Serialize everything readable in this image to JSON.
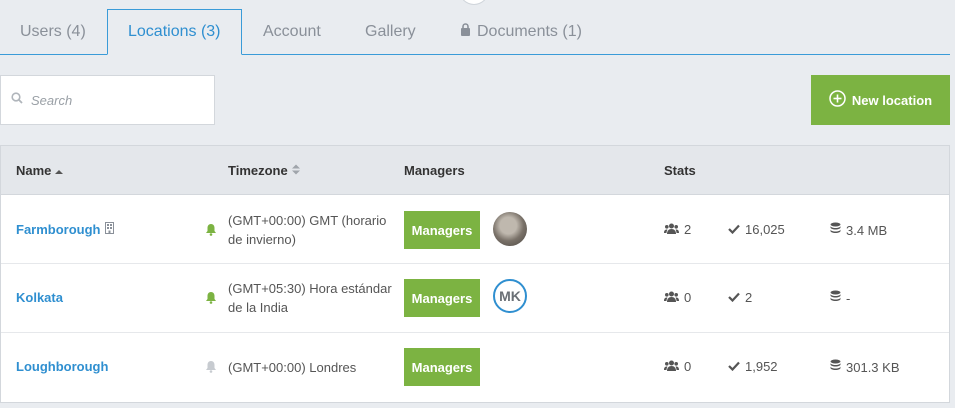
{
  "tabs": [
    {
      "label": "Users (4)"
    },
    {
      "label": "Locations (3)"
    },
    {
      "label": "Account"
    },
    {
      "label": "Gallery"
    },
    {
      "label": "Documents (1)"
    }
  ],
  "active_tab": "Locations (3)",
  "search": {
    "placeholder": "Search"
  },
  "new_location_button": {
    "label": "New location"
  },
  "table": {
    "headers": {
      "name": "Name",
      "timezone": "Timezone",
      "managers": "Managers",
      "stats": "Stats"
    },
    "rows": [
      {
        "name": "Farmborough",
        "timezone": "(GMT+00:00) GMT (horario de invierno)",
        "managers_label": "Managers",
        "manager_avatar": "photo",
        "users": "2",
        "checks": "16,025",
        "storage": "3.4 MB",
        "bell_active": true
      },
      {
        "name": "Kolkata",
        "timezone": "(GMT+05:30) Hora estándar de la India",
        "managers_label": "Managers",
        "manager_avatar": "MK",
        "users": "0",
        "checks": "2",
        "storage": "-",
        "bell_active": true
      },
      {
        "name": "Loughborough",
        "timezone": "(GMT+00:00) Londres",
        "managers_label": "Managers",
        "manager_avatar": "",
        "users": "0",
        "checks": "1,952",
        "storage": "301.3 KB",
        "bell_active": false
      }
    ]
  },
  "colors": {
    "accent": "#2f8fd0",
    "green": "#7cb342",
    "bell_active": "#7cb342",
    "bell_inactive": "#c7cbd0"
  }
}
